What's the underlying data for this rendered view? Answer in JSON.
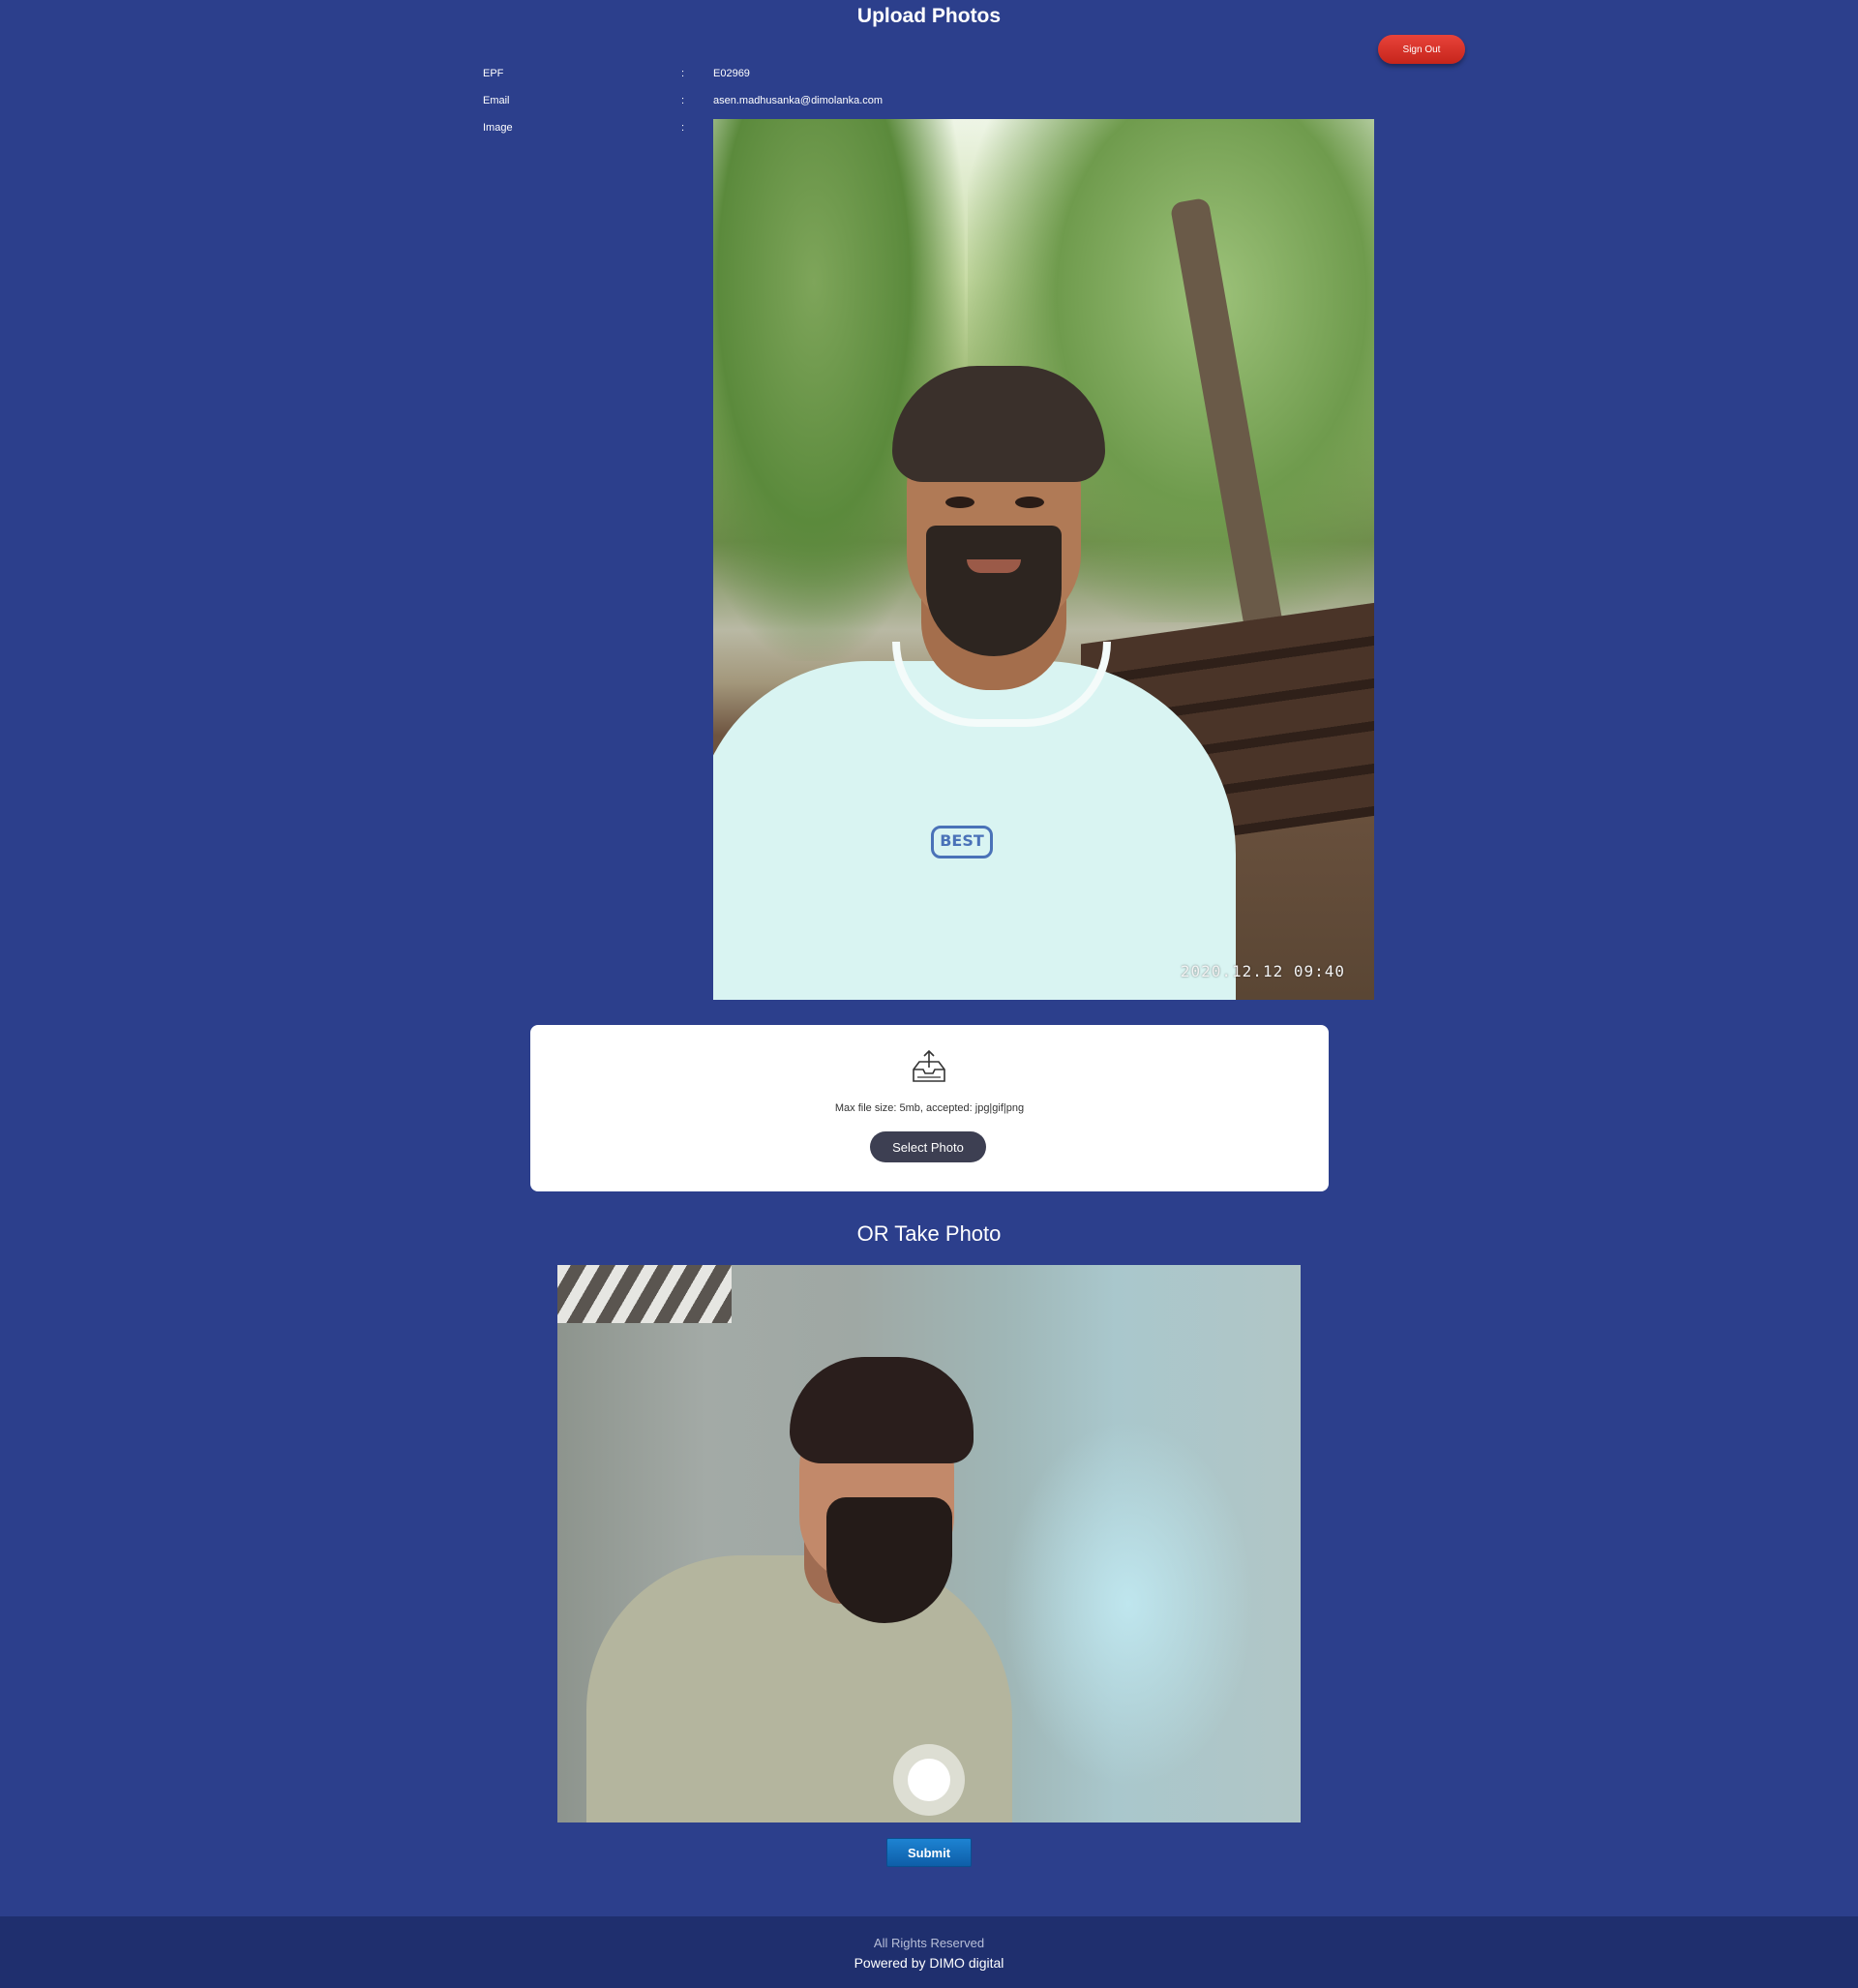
{
  "header": {
    "title": "Upload Photos",
    "sign_out_label": "Sign Out"
  },
  "profile": {
    "fields": [
      {
        "label": "EPF",
        "separator": ":",
        "value": "E02969"
      },
      {
        "label": "Email",
        "separator": ":",
        "value": "asen.madhusanka@dimolanka.com"
      },
      {
        "label": "Image",
        "separator": ":",
        "value": ""
      }
    ],
    "photo_timestamp": "2020.12.12 09:40",
    "shirt_logo_text": "BEST"
  },
  "upload": {
    "icon": "upload-tray-icon",
    "hint": "Max file size: 5mb, accepted: jpg|gif|png",
    "select_label": "Select Photo"
  },
  "camera": {
    "heading": "OR Take Photo",
    "capture_icon": "capture-circle-icon"
  },
  "actions": {
    "submit_label": "Submit"
  },
  "footer": {
    "rights": "All Rights Reserved",
    "powered_by": "Powered by DIMO digital"
  },
  "colors": {
    "background": "#2c3f8c",
    "footer_background": "#1f2f6e",
    "sign_out": "#d9342a",
    "submit": "#1374c0",
    "select_button": "#3d3f52"
  }
}
